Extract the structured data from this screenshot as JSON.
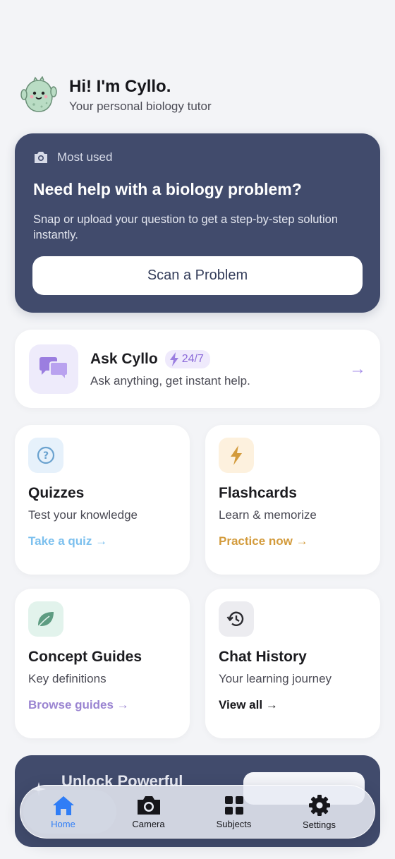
{
  "greeting": {
    "title": "Hi! I'm Cyllo.",
    "subtitle": "Your personal biology tutor"
  },
  "hero": {
    "tag": "Most used",
    "title": "Need help with a biology problem?",
    "description": "Snap or upload your question to get a step-by-step solution instantly.",
    "button": "Scan a Problem"
  },
  "ask": {
    "title": "Ask Cyllo",
    "badge": "24/7",
    "subtitle": "Ask anything, get instant help.",
    "arrow": "→"
  },
  "cards": {
    "quizzes": {
      "title": "Quizzes",
      "subtitle": "Test your knowledge",
      "link": "Take a quiz →",
      "color": "#7cc0ee"
    },
    "flashcards": {
      "title": "Flashcards",
      "subtitle": "Learn & memorize",
      "link": "Practice now →",
      "color": "#d39b3c"
    },
    "guides": {
      "title": "Concept Guides",
      "subtitle": "Key definitions",
      "link": "Browse guides →",
      "color": "#9a84d1"
    },
    "history": {
      "title": "Chat History",
      "subtitle": "Your learning journey",
      "link": "View all →",
      "color": "#16161a"
    }
  },
  "promo": {
    "title": "Unlock Powerful"
  },
  "tabs": [
    {
      "label": "Home",
      "icon": "home-icon",
      "active": true
    },
    {
      "label": "Camera",
      "icon": "camera-icon"
    },
    {
      "label": "Subjects",
      "icon": "grid-icon"
    },
    {
      "label": "Settings",
      "icon": "gear-icon"
    }
  ],
  "colors": {
    "hero_bg": "#414b6c",
    "accent_purple": "#8b6ad9",
    "tab_active": "#2f7df6"
  }
}
